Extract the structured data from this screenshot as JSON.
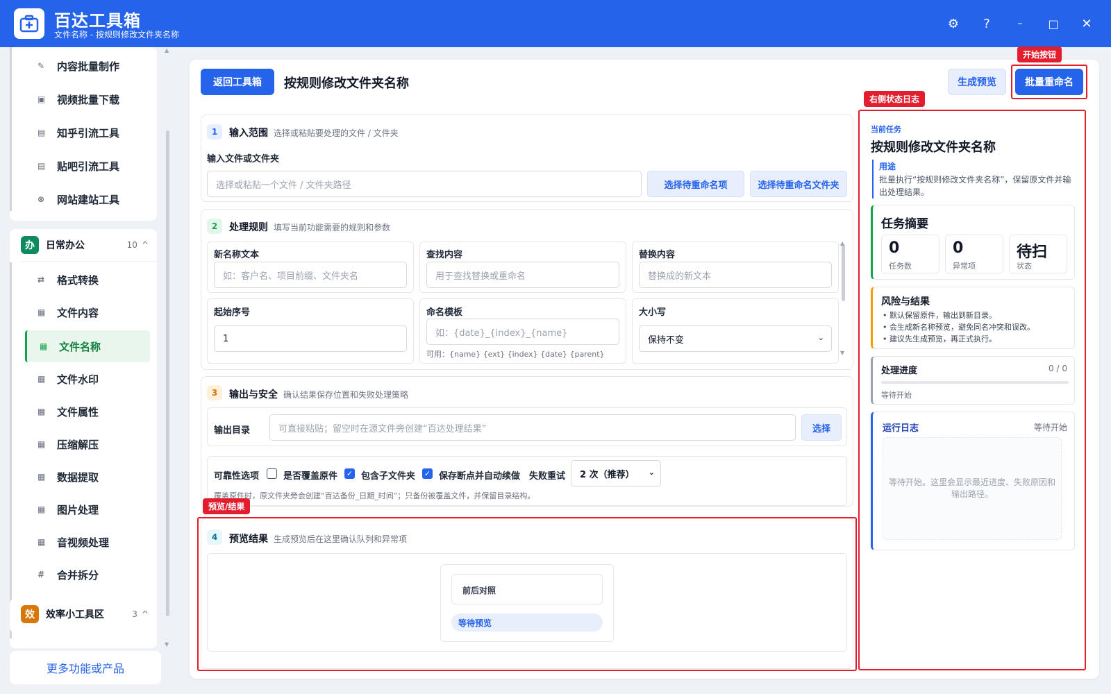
{
  "app": {
    "title": "百达工具箱",
    "subtitle": "文件名称 - 按规则修改文件夹名称",
    "controls": [
      "⚙",
      "?",
      "–",
      "□",
      "✕"
    ]
  },
  "sidebar": {
    "top_items": [
      {
        "label": "内容批量制作",
        "icon": "pen-icon"
      },
      {
        "label": "视频批量下载",
        "icon": "video-icon"
      },
      {
        "label": "知乎引流工具",
        "icon": "zhihu-icon"
      },
      {
        "label": "贴吧引流工具",
        "icon": "tieba-icon"
      },
      {
        "label": "网站建站工具",
        "icon": "web-icon"
      }
    ],
    "group_office": {
      "badge": "办",
      "name": "日常办公",
      "count": "10",
      "caret": "^"
    },
    "office_items": [
      {
        "label": "格式转换",
        "icon": "⇄"
      },
      {
        "label": "文件内容",
        "icon": "▦"
      },
      {
        "label": "文件名称",
        "icon": "▦",
        "active": true
      },
      {
        "label": "文件水印",
        "icon": "▦"
      },
      {
        "label": "文件属性",
        "icon": "▦"
      },
      {
        "label": "压缩解压",
        "icon": "▦"
      },
      {
        "label": "数据提取",
        "icon": "▦"
      },
      {
        "label": "图片处理",
        "icon": "▦"
      },
      {
        "label": "音视频处理",
        "icon": "▦"
      },
      {
        "label": "合并拆分",
        "icon": "#"
      }
    ],
    "group_tools": {
      "badge": "效",
      "name": "效率小工具区",
      "count": "3",
      "caret": "^"
    },
    "more_link": "更多功能或产品"
  },
  "header": {
    "back_label": "返回工具箱",
    "title": "按规则修改文件夹名称",
    "preview_label": "生成预览",
    "start_label": "批量重命名"
  },
  "annotations": {
    "start": "开始按钮",
    "log": "右侧状态日志",
    "preview": "预览/结果"
  },
  "section1": {
    "num": "1",
    "title": "输入范围",
    "desc": "选择或粘贴要处理的文件 / 文件夹",
    "field_label": "输入文件或文件夹",
    "placeholder": "选择或粘贴一个文件 / 文件夹路径",
    "btn_items": "选择待重命名项",
    "btn_folder": "选择待重命名文件夹"
  },
  "section2": {
    "num": "2",
    "title": "处理规则",
    "desc": "填写当前功能需要的规则和参数",
    "new_name_label": "新名称文本",
    "new_name_placeholder": "如：客户名、项目前缀、文件夹名",
    "find_label": "查找内容",
    "find_placeholder": "用于查找替换或重命名",
    "replace_label": "替换内容",
    "replace_placeholder": "替换成的新文本",
    "start_seq_label": "起始序号",
    "start_seq_value": "1",
    "template_label": "命名模板",
    "template_placeholder": "如：{date}_{index}_{name}",
    "template_hint": "可用：{name} {ext} {index} {date} {parent}",
    "case_label": "大小写",
    "case_value": "保持不变"
  },
  "section3": {
    "num": "3",
    "title": "输出与安全",
    "desc": "确认结果保存位置和失败处理策略",
    "output_label": "输出目录",
    "output_placeholder": "可直接粘贴；留空时在源文件旁创建“百达处理结果”",
    "choose_label": "选择",
    "reliability_label": "可靠性选项",
    "overwrite_label": "是否覆盖原件",
    "overwrite_checked": false,
    "subfolder_label": "包含子文件夹",
    "subfolder_checked": true,
    "resume_label": "保存断点并自动续做",
    "resume_checked": true,
    "retry_label": "失败重试",
    "retry_value": "2 次（推荐）",
    "note": "覆盖原件时，原文件夹旁会创建“百达备份_日期_时间”；只备份被覆盖文件，并保留目录结构。"
  },
  "section4": {
    "num": "4",
    "title": "预览结果",
    "desc": "生成预览后在这里确认队列和异常项",
    "compare_label": "前后对照",
    "waiting_label": "等待预览"
  },
  "right_panel": {
    "current_task_label": "当前任务",
    "task_title": "按规则修改文件夹名称",
    "purpose_label": "用途",
    "purpose_text": "批量执行“按规则修改文件夹名称”，保留原文件并输出处理结果。",
    "summary_title": "任务摘要",
    "stats": [
      {
        "value": "0",
        "label": "任务数"
      },
      {
        "value": "0",
        "label": "异常项"
      },
      {
        "value": "待扫",
        "label": "状态"
      }
    ],
    "risk_title": "风险与结果",
    "risks": [
      "默认保留原件，输出到新目录。",
      "会生成新名称预览，避免同名冲突和误改。",
      "建议先生成预览，再正式执行。"
    ],
    "progress_title": "处理进度",
    "progress_count": "0 / 0",
    "progress_fraction": 0,
    "progress_status": "等待开始",
    "log_title": "运行日志",
    "log_status": "等待开始",
    "log_placeholder": "等待开始。这里会显示最近进度、失败原因和输出路径。"
  },
  "colors": {
    "primary": "#2563eb",
    "annotation": "#e11d2e",
    "active_green": "#16a34a",
    "office_badge": "#0f8a5f",
    "tools_badge": "#d97706"
  }
}
